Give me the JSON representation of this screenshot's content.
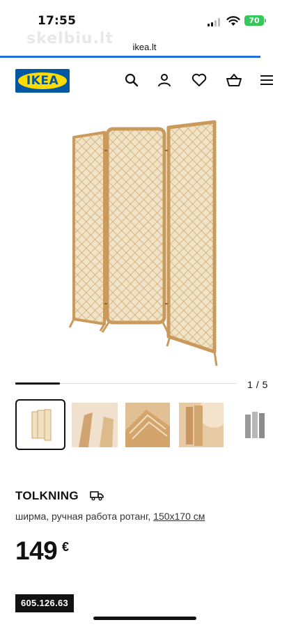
{
  "status_bar": {
    "time": "17:55",
    "battery": "70",
    "watermark": "skelbiu.lt"
  },
  "browser": {
    "url": "ikea.lt",
    "load_progress": 0.9
  },
  "header": {
    "logo_text": "IKEA",
    "icons": [
      "search-icon",
      "account-icon",
      "heart-icon",
      "cart-icon",
      "menu-icon"
    ]
  },
  "gallery": {
    "counter": "1 / 5",
    "current_index": 1,
    "total": 5,
    "thumbnails": [
      "thumbnail-1",
      "thumbnail-2",
      "thumbnail-3",
      "thumbnail-4",
      "thumbnail-5"
    ]
  },
  "product": {
    "name": "TOLKNING",
    "description": "ширма, ручная работа ротанг, ",
    "dimensions": "150x170 см",
    "price_integer": "149",
    "price_currency": "€",
    "article_number": "605.126.63"
  },
  "colors": {
    "ikea_blue": "#0058a3",
    "ikea_yellow": "#ffdb00",
    "rattan": "#d8b783",
    "browser_blue": "#1e6fd9",
    "battery_green": "#34c759"
  }
}
